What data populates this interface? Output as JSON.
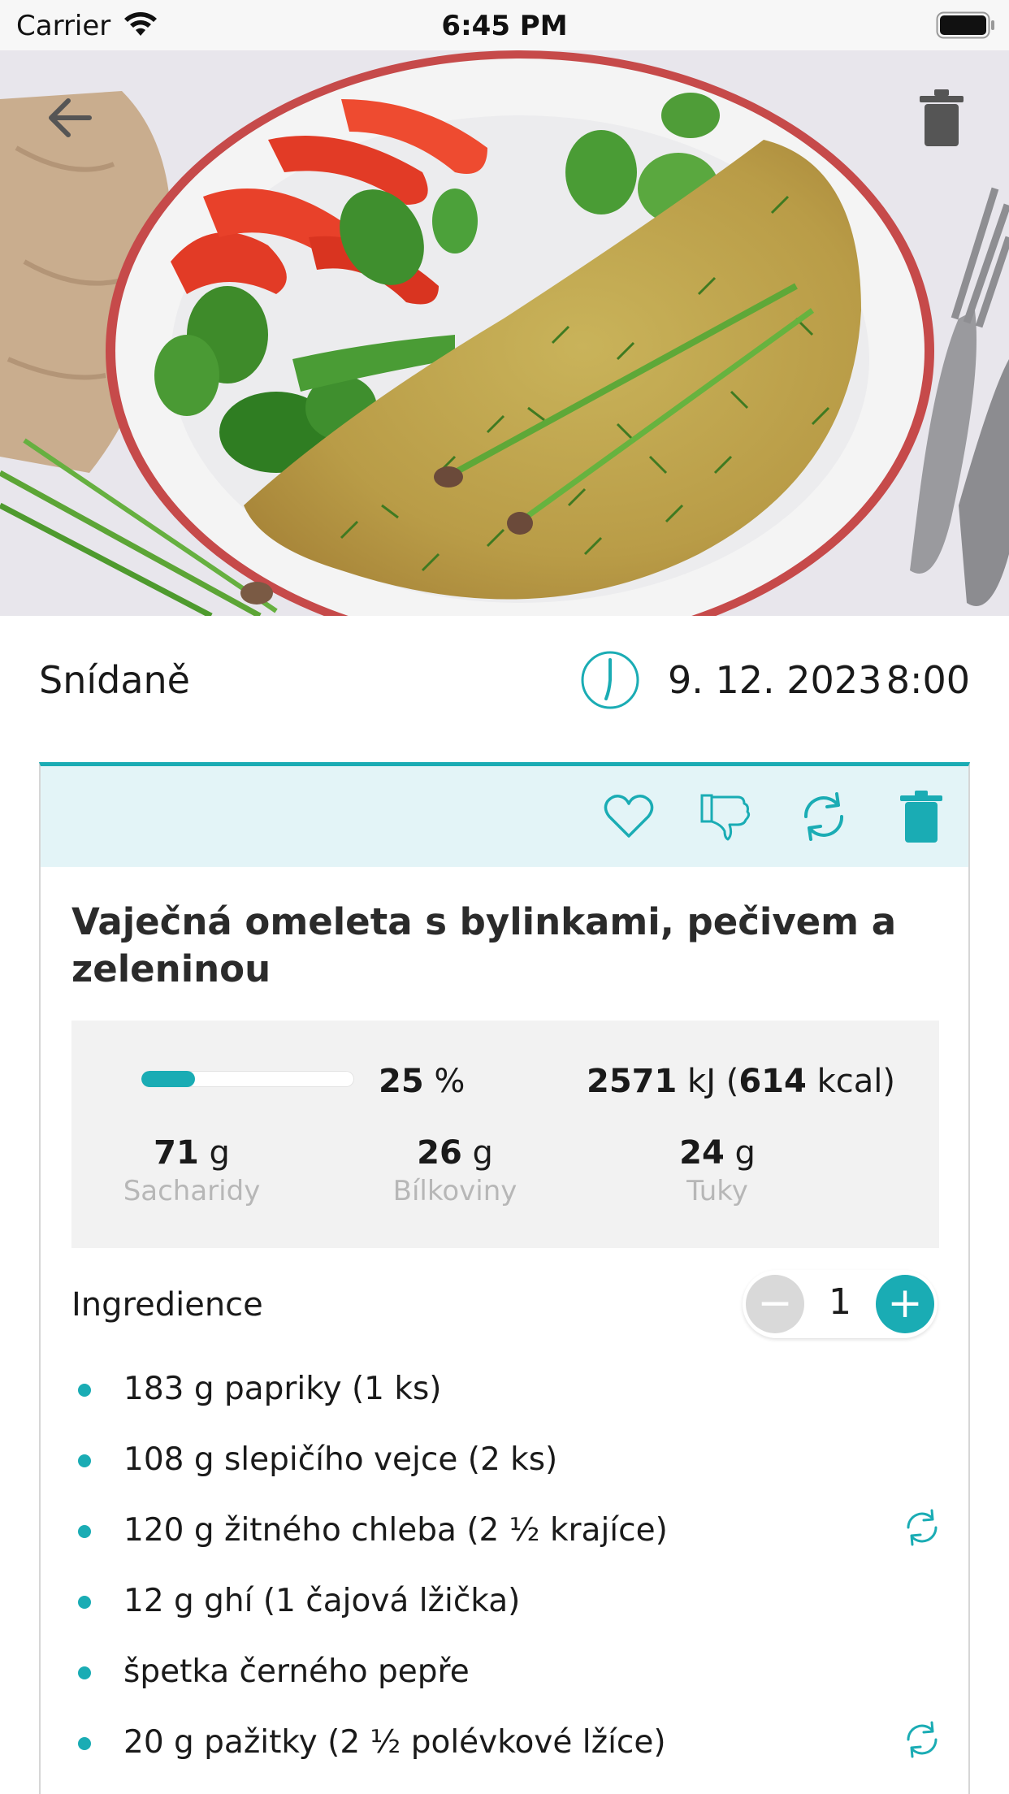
{
  "status_bar": {
    "carrier": "Carrier",
    "time": "6:45 PM"
  },
  "header": {
    "back_icon": "arrow-left-icon",
    "delete_icon": "trash-icon"
  },
  "meal": {
    "name": "Snídaně",
    "date": "9. 12. 2023",
    "time": "8:00",
    "clock_icon": "clock-icon"
  },
  "card": {
    "toolbar_icons": [
      "heart-icon",
      "thumbs-down-icon",
      "refresh-icon",
      "trash-icon"
    ],
    "title": "Vaječná omeleta s bylinkami, pečivem a zeleninou",
    "nutrition": {
      "percent_value": "25",
      "percent_unit": "%",
      "progress_fraction": 0.25,
      "kj_value": "2571",
      "kj_unit": "kJ",
      "kcal_value": "614",
      "kcal_unit": "kcal",
      "macros": [
        {
          "value": "71",
          "unit": "g",
          "label": "Sacharidy"
        },
        {
          "value": "26",
          "unit": "g",
          "label": "Bílkoviny"
        },
        {
          "value": "24",
          "unit": "g",
          "label": "Tuky"
        }
      ]
    },
    "ingredients_heading": "Ingredience",
    "portion": {
      "minus": "−",
      "value": "1",
      "plus": "+"
    },
    "ingredients": [
      {
        "text": "183 g papriky (1 ks)",
        "swappable": false
      },
      {
        "text": "108 g slepičího vejce (2 ks)",
        "swappable": false
      },
      {
        "text": "120 g žitného chleba (2 ½ krajíce)",
        "swappable": true
      },
      {
        "text": "12 g ghí (1 čajová lžička)",
        "swappable": false
      },
      {
        "text": "špetka černého pepře",
        "swappable": false
      },
      {
        "text": "20 g pažitky (2 ½ polévkové lžíce)",
        "swappable": true
      }
    ]
  },
  "colors": {
    "accent": "#1aacb4",
    "toolbar_bg": "#e3f4f7",
    "nutrition_bg": "#f2f2f2"
  }
}
